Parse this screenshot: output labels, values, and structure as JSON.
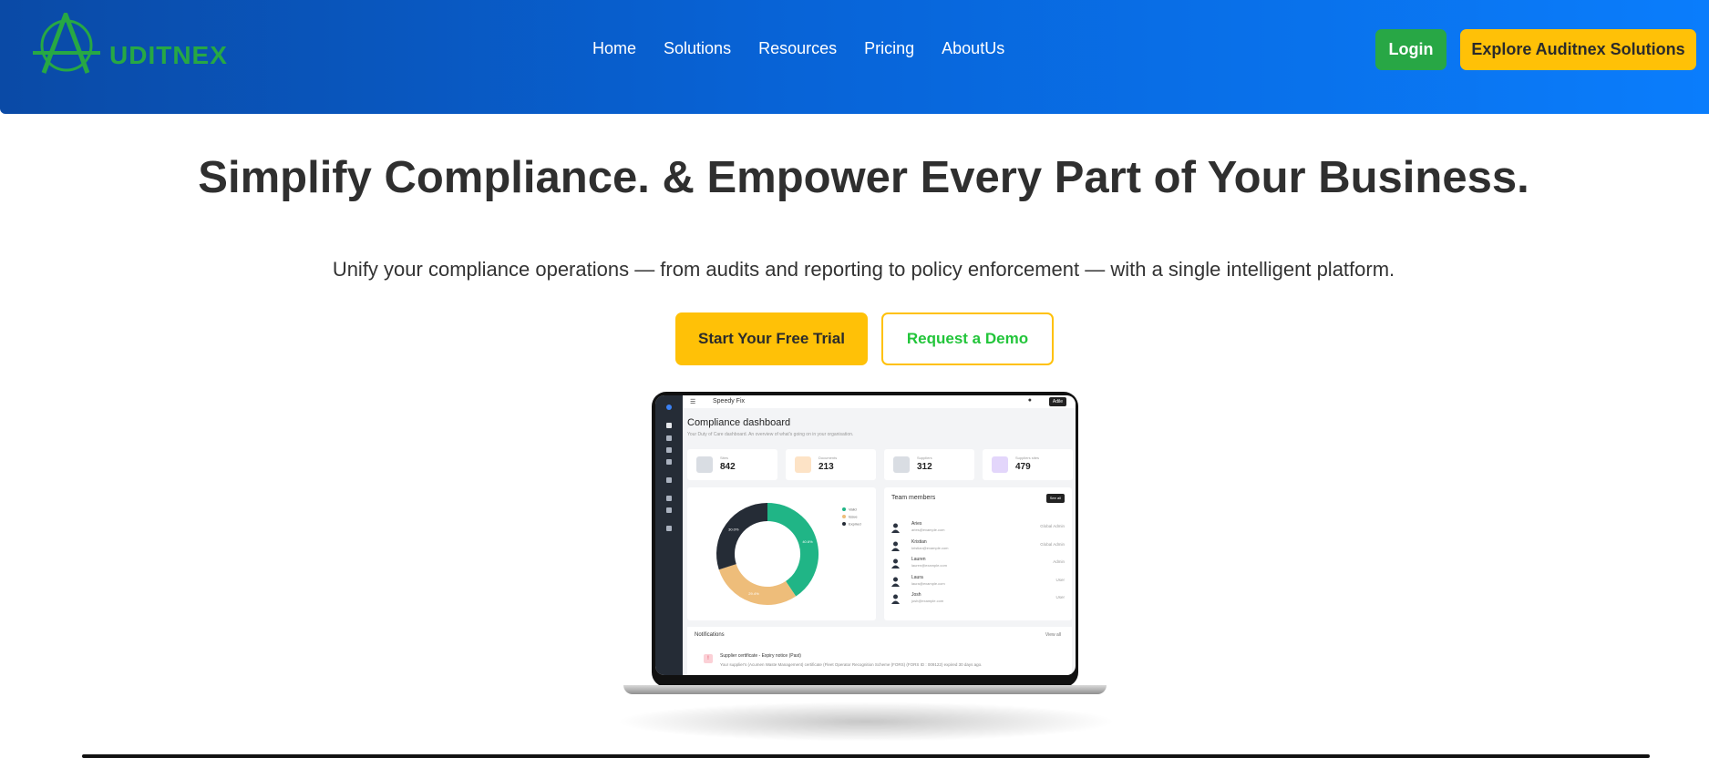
{
  "brand": {
    "name": "UDITNEX",
    "accent": "#27a844"
  },
  "nav": {
    "items": [
      "Home",
      "Solutions",
      "Resources",
      "Pricing",
      "AboutUs"
    ]
  },
  "header_buttons": {
    "login": "Login",
    "explore": "Explore Auditnex Solutions"
  },
  "hero": {
    "title": "Simplify Compliance. & Empower Every Part of Your Business.",
    "subtitle": "Unify your compliance operations — from audits and reporting to policy enforcement — with a single intelligent platform.",
    "primary_cta": "Start Your Free Trial",
    "secondary_cta": "Request a Demo"
  },
  "colors": {
    "header_start": "#0a4aa6",
    "header_end": "#0a7dfc",
    "yellow": "#ffc107",
    "green": "#28a745"
  },
  "dashboard": {
    "app_name": "Speedy Fix",
    "user": "Adile",
    "title": "Compliance dashboard",
    "description": "Your Duty of Care dashboard. An overview of what's going on in your organisation.",
    "stats": [
      {
        "label": "Sites",
        "value": "842",
        "icon": "location-pin-icon",
        "color": "#d9dde3"
      },
      {
        "label": "Documents",
        "value": "213",
        "icon": "document-icon",
        "color": "#fde3c6"
      },
      {
        "label": "Suppliers",
        "value": "312",
        "icon": "factory-icon",
        "color": "#d9dde3"
      },
      {
        "label": "Suppliers sites",
        "value": "479",
        "icon": "building-icon",
        "color": "#e3d6fb"
      }
    ],
    "donut": {
      "segments": [
        {
          "name": "Valid",
          "value": 40.6,
          "label": "40.6%",
          "color": "#20b586"
        },
        {
          "name": "Issue",
          "value": 29.4,
          "label": "29.4%",
          "color": "#eebd7a"
        },
        {
          "name": "Expired",
          "value": 30.0,
          "label": "30.0%",
          "color": "#252c36"
        }
      ]
    },
    "team": {
      "title": "Team members",
      "see_all": "See all",
      "members": [
        {
          "name": "Aries",
          "email": "aries@example.com",
          "role": "Global Admin"
        },
        {
          "name": "Kristian",
          "email": "kristian@example.com",
          "role": "Global Admin"
        },
        {
          "name": "Lauren",
          "email": "lauren@example.com",
          "role": "Admin"
        },
        {
          "name": "Laura",
          "email": "laura@example.com",
          "role": "User"
        },
        {
          "name": "Josh",
          "email": "josh@example.com",
          "role": "User"
        }
      ]
    },
    "notifications": {
      "title": "Notifications",
      "view_all": "View all",
      "item_title": "Supplier certificate - Expiry notice (Past)",
      "item_text": "Your supplier's (Acumen Waste Management) certificate (Fleet Operator Recognition Scheme (FORS) (FORS ID : 009122) expired 30 days ago."
    }
  }
}
